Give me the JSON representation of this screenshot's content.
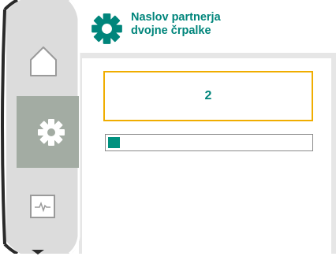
{
  "header": {
    "title_line1": "Naslov partnerja",
    "title_line2": "dvojne črpalke",
    "icon": "gear-icon"
  },
  "value": {
    "text": "2"
  },
  "progress": {
    "fraction": 0.06
  },
  "sidebar": {
    "items": [
      {
        "icon": "home-icon",
        "active": false
      },
      {
        "icon": "gear-icon",
        "active": true
      },
      {
        "icon": "diagnostics-icon",
        "active": false
      }
    ],
    "scroll_indicator": "chevron-down-icon"
  },
  "colors": {
    "accent": "#00857b",
    "selection": "#f0ad00",
    "side_bg": "#dcdcdc",
    "side_active": "#a3aca3",
    "frame_grey": "#e6e6e6"
  }
}
